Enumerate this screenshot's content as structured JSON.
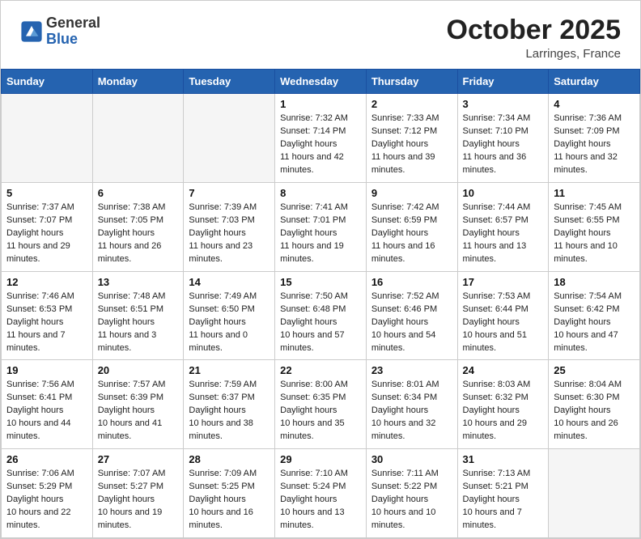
{
  "header": {
    "logo": {
      "general": "General",
      "blue": "Blue"
    },
    "month": "October 2025",
    "location": "Larringes, France"
  },
  "weekdays": [
    "Sunday",
    "Monday",
    "Tuesday",
    "Wednesday",
    "Thursday",
    "Friday",
    "Saturday"
  ],
  "weeks": [
    [
      {
        "day": "",
        "empty": true
      },
      {
        "day": "",
        "empty": true
      },
      {
        "day": "",
        "empty": true
      },
      {
        "day": "1",
        "sunrise": "7:32 AM",
        "sunset": "7:14 PM",
        "daylight": "11 hours and 42 minutes."
      },
      {
        "day": "2",
        "sunrise": "7:33 AM",
        "sunset": "7:12 PM",
        "daylight": "11 hours and 39 minutes."
      },
      {
        "day": "3",
        "sunrise": "7:34 AM",
        "sunset": "7:10 PM",
        "daylight": "11 hours and 36 minutes."
      },
      {
        "day": "4",
        "sunrise": "7:36 AM",
        "sunset": "7:09 PM",
        "daylight": "11 hours and 32 minutes."
      }
    ],
    [
      {
        "day": "5",
        "sunrise": "7:37 AM",
        "sunset": "7:07 PM",
        "daylight": "11 hours and 29 minutes."
      },
      {
        "day": "6",
        "sunrise": "7:38 AM",
        "sunset": "7:05 PM",
        "daylight": "11 hours and 26 minutes."
      },
      {
        "day": "7",
        "sunrise": "7:39 AM",
        "sunset": "7:03 PM",
        "daylight": "11 hours and 23 minutes."
      },
      {
        "day": "8",
        "sunrise": "7:41 AM",
        "sunset": "7:01 PM",
        "daylight": "11 hours and 19 minutes."
      },
      {
        "day": "9",
        "sunrise": "7:42 AM",
        "sunset": "6:59 PM",
        "daylight": "11 hours and 16 minutes."
      },
      {
        "day": "10",
        "sunrise": "7:44 AM",
        "sunset": "6:57 PM",
        "daylight": "11 hours and 13 minutes."
      },
      {
        "day": "11",
        "sunrise": "7:45 AM",
        "sunset": "6:55 PM",
        "daylight": "11 hours and 10 minutes."
      }
    ],
    [
      {
        "day": "12",
        "sunrise": "7:46 AM",
        "sunset": "6:53 PM",
        "daylight": "11 hours and 7 minutes."
      },
      {
        "day": "13",
        "sunrise": "7:48 AM",
        "sunset": "6:51 PM",
        "daylight": "11 hours and 3 minutes."
      },
      {
        "day": "14",
        "sunrise": "7:49 AM",
        "sunset": "6:50 PM",
        "daylight": "11 hours and 0 minutes."
      },
      {
        "day": "15",
        "sunrise": "7:50 AM",
        "sunset": "6:48 PM",
        "daylight": "10 hours and 57 minutes."
      },
      {
        "day": "16",
        "sunrise": "7:52 AM",
        "sunset": "6:46 PM",
        "daylight": "10 hours and 54 minutes."
      },
      {
        "day": "17",
        "sunrise": "7:53 AM",
        "sunset": "6:44 PM",
        "daylight": "10 hours and 51 minutes."
      },
      {
        "day": "18",
        "sunrise": "7:54 AM",
        "sunset": "6:42 PM",
        "daylight": "10 hours and 47 minutes."
      }
    ],
    [
      {
        "day": "19",
        "sunrise": "7:56 AM",
        "sunset": "6:41 PM",
        "daylight": "10 hours and 44 minutes."
      },
      {
        "day": "20",
        "sunrise": "7:57 AM",
        "sunset": "6:39 PM",
        "daylight": "10 hours and 41 minutes."
      },
      {
        "day": "21",
        "sunrise": "7:59 AM",
        "sunset": "6:37 PM",
        "daylight": "10 hours and 38 minutes."
      },
      {
        "day": "22",
        "sunrise": "8:00 AM",
        "sunset": "6:35 PM",
        "daylight": "10 hours and 35 minutes."
      },
      {
        "day": "23",
        "sunrise": "8:01 AM",
        "sunset": "6:34 PM",
        "daylight": "10 hours and 32 minutes."
      },
      {
        "day": "24",
        "sunrise": "8:03 AM",
        "sunset": "6:32 PM",
        "daylight": "10 hours and 29 minutes."
      },
      {
        "day": "25",
        "sunrise": "8:04 AM",
        "sunset": "6:30 PM",
        "daylight": "10 hours and 26 minutes."
      }
    ],
    [
      {
        "day": "26",
        "sunrise": "7:06 AM",
        "sunset": "5:29 PM",
        "daylight": "10 hours and 22 minutes."
      },
      {
        "day": "27",
        "sunrise": "7:07 AM",
        "sunset": "5:27 PM",
        "daylight": "10 hours and 19 minutes."
      },
      {
        "day": "28",
        "sunrise": "7:09 AM",
        "sunset": "5:25 PM",
        "daylight": "10 hours and 16 minutes."
      },
      {
        "day": "29",
        "sunrise": "7:10 AM",
        "sunset": "5:24 PM",
        "daylight": "10 hours and 13 minutes."
      },
      {
        "day": "30",
        "sunrise": "7:11 AM",
        "sunset": "5:22 PM",
        "daylight": "10 hours and 10 minutes."
      },
      {
        "day": "31",
        "sunrise": "7:13 AM",
        "sunset": "5:21 PM",
        "daylight": "10 hours and 7 minutes."
      },
      {
        "day": "",
        "empty": true
      }
    ]
  ]
}
